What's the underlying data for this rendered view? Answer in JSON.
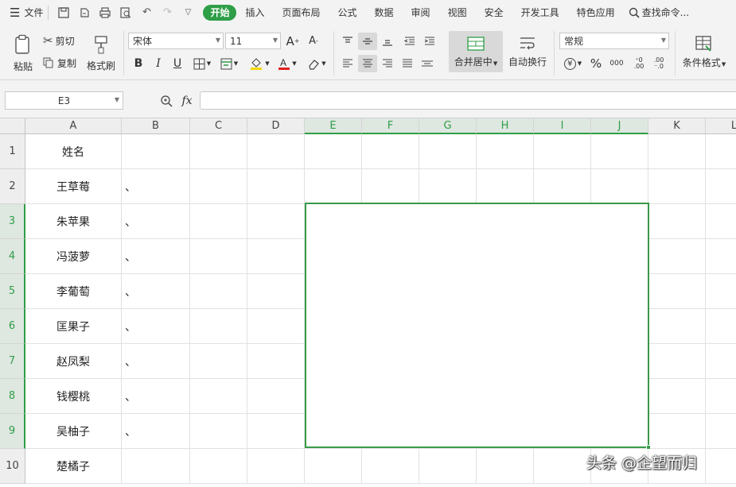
{
  "menubar": {
    "file_label": "文件",
    "tabs": [
      {
        "label": "开始",
        "active": true
      },
      {
        "label": "插入",
        "active": false
      },
      {
        "label": "页面布局",
        "active": false
      },
      {
        "label": "公式",
        "active": false
      },
      {
        "label": "数据",
        "active": false
      },
      {
        "label": "审阅",
        "active": false
      },
      {
        "label": "视图",
        "active": false
      },
      {
        "label": "安全",
        "active": false
      },
      {
        "label": "开发工具",
        "active": false
      },
      {
        "label": "特色应用",
        "active": false
      }
    ],
    "search_label": "查找命令..."
  },
  "ribbon": {
    "paste": "粘贴",
    "cut": "剪切",
    "copy": "复制",
    "format_painter": "格式刷",
    "font_name": "宋体",
    "font_size": "11",
    "merge_center": "合并居中",
    "wrap_text": "自动换行",
    "number_format": "常规",
    "currency_symbol": "¥",
    "percent_symbol": "%",
    "thousands_symbol": "000",
    "conditional_format": "条件格式"
  },
  "formula_bar": {
    "name_box": "E3",
    "fx_label": "fx",
    "content": ""
  },
  "sheet": {
    "columns": [
      "A",
      "B",
      "C",
      "D",
      "E",
      "F",
      "G",
      "H",
      "I",
      "J",
      "K",
      "L"
    ],
    "selected_columns": [
      "E",
      "F",
      "G",
      "H",
      "I",
      "J"
    ],
    "rows": [
      "1",
      "2",
      "3",
      "4",
      "5",
      "6",
      "7",
      "8",
      "9",
      "10"
    ],
    "selected_rows": [
      "3",
      "4",
      "5",
      "6",
      "7",
      "8",
      "9"
    ],
    "col_a_values": [
      "姓名",
      "王草莓",
      "朱苹果",
      "冯菠萝",
      "李葡萄",
      "匡果子",
      "赵凤梨",
      "钱樱桃",
      "吴柚子",
      "楚橘子"
    ],
    "col_b_values": [
      "",
      "、",
      "、",
      "、",
      "、",
      "、",
      "、",
      "、",
      "、",
      ""
    ],
    "selection_color": "#3a9a48"
  },
  "watermark": "头条 @企望而归"
}
